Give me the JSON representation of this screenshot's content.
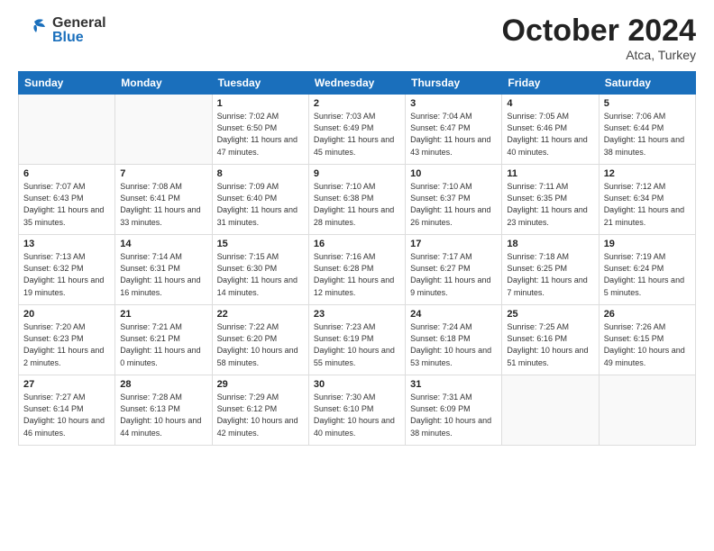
{
  "header": {
    "logo_general": "General",
    "logo_blue": "Blue",
    "month": "October 2024",
    "location": "Atca, Turkey"
  },
  "weekdays": [
    "Sunday",
    "Monday",
    "Tuesday",
    "Wednesday",
    "Thursday",
    "Friday",
    "Saturday"
  ],
  "weeks": [
    [
      {
        "day": "",
        "info": ""
      },
      {
        "day": "",
        "info": ""
      },
      {
        "day": "1",
        "info": "Sunrise: 7:02 AM\nSunset: 6:50 PM\nDaylight: 11 hours and 47 minutes."
      },
      {
        "day": "2",
        "info": "Sunrise: 7:03 AM\nSunset: 6:49 PM\nDaylight: 11 hours and 45 minutes."
      },
      {
        "day": "3",
        "info": "Sunrise: 7:04 AM\nSunset: 6:47 PM\nDaylight: 11 hours and 43 minutes."
      },
      {
        "day": "4",
        "info": "Sunrise: 7:05 AM\nSunset: 6:46 PM\nDaylight: 11 hours and 40 minutes."
      },
      {
        "day": "5",
        "info": "Sunrise: 7:06 AM\nSunset: 6:44 PM\nDaylight: 11 hours and 38 minutes."
      }
    ],
    [
      {
        "day": "6",
        "info": "Sunrise: 7:07 AM\nSunset: 6:43 PM\nDaylight: 11 hours and 35 minutes."
      },
      {
        "day": "7",
        "info": "Sunrise: 7:08 AM\nSunset: 6:41 PM\nDaylight: 11 hours and 33 minutes."
      },
      {
        "day": "8",
        "info": "Sunrise: 7:09 AM\nSunset: 6:40 PM\nDaylight: 11 hours and 31 minutes."
      },
      {
        "day": "9",
        "info": "Sunrise: 7:10 AM\nSunset: 6:38 PM\nDaylight: 11 hours and 28 minutes."
      },
      {
        "day": "10",
        "info": "Sunrise: 7:10 AM\nSunset: 6:37 PM\nDaylight: 11 hours and 26 minutes."
      },
      {
        "day": "11",
        "info": "Sunrise: 7:11 AM\nSunset: 6:35 PM\nDaylight: 11 hours and 23 minutes."
      },
      {
        "day": "12",
        "info": "Sunrise: 7:12 AM\nSunset: 6:34 PM\nDaylight: 11 hours and 21 minutes."
      }
    ],
    [
      {
        "day": "13",
        "info": "Sunrise: 7:13 AM\nSunset: 6:32 PM\nDaylight: 11 hours and 19 minutes."
      },
      {
        "day": "14",
        "info": "Sunrise: 7:14 AM\nSunset: 6:31 PM\nDaylight: 11 hours and 16 minutes."
      },
      {
        "day": "15",
        "info": "Sunrise: 7:15 AM\nSunset: 6:30 PM\nDaylight: 11 hours and 14 minutes."
      },
      {
        "day": "16",
        "info": "Sunrise: 7:16 AM\nSunset: 6:28 PM\nDaylight: 11 hours and 12 minutes."
      },
      {
        "day": "17",
        "info": "Sunrise: 7:17 AM\nSunset: 6:27 PM\nDaylight: 11 hours and 9 minutes."
      },
      {
        "day": "18",
        "info": "Sunrise: 7:18 AM\nSunset: 6:25 PM\nDaylight: 11 hours and 7 minutes."
      },
      {
        "day": "19",
        "info": "Sunrise: 7:19 AM\nSunset: 6:24 PM\nDaylight: 11 hours and 5 minutes."
      }
    ],
    [
      {
        "day": "20",
        "info": "Sunrise: 7:20 AM\nSunset: 6:23 PM\nDaylight: 11 hours and 2 minutes."
      },
      {
        "day": "21",
        "info": "Sunrise: 7:21 AM\nSunset: 6:21 PM\nDaylight: 11 hours and 0 minutes."
      },
      {
        "day": "22",
        "info": "Sunrise: 7:22 AM\nSunset: 6:20 PM\nDaylight: 10 hours and 58 minutes."
      },
      {
        "day": "23",
        "info": "Sunrise: 7:23 AM\nSunset: 6:19 PM\nDaylight: 10 hours and 55 minutes."
      },
      {
        "day": "24",
        "info": "Sunrise: 7:24 AM\nSunset: 6:18 PM\nDaylight: 10 hours and 53 minutes."
      },
      {
        "day": "25",
        "info": "Sunrise: 7:25 AM\nSunset: 6:16 PM\nDaylight: 10 hours and 51 minutes."
      },
      {
        "day": "26",
        "info": "Sunrise: 7:26 AM\nSunset: 6:15 PM\nDaylight: 10 hours and 49 minutes."
      }
    ],
    [
      {
        "day": "27",
        "info": "Sunrise: 7:27 AM\nSunset: 6:14 PM\nDaylight: 10 hours and 46 minutes."
      },
      {
        "day": "28",
        "info": "Sunrise: 7:28 AM\nSunset: 6:13 PM\nDaylight: 10 hours and 44 minutes."
      },
      {
        "day": "29",
        "info": "Sunrise: 7:29 AM\nSunset: 6:12 PM\nDaylight: 10 hours and 42 minutes."
      },
      {
        "day": "30",
        "info": "Sunrise: 7:30 AM\nSunset: 6:10 PM\nDaylight: 10 hours and 40 minutes."
      },
      {
        "day": "31",
        "info": "Sunrise: 7:31 AM\nSunset: 6:09 PM\nDaylight: 10 hours and 38 minutes."
      },
      {
        "day": "",
        "info": ""
      },
      {
        "day": "",
        "info": ""
      }
    ]
  ]
}
